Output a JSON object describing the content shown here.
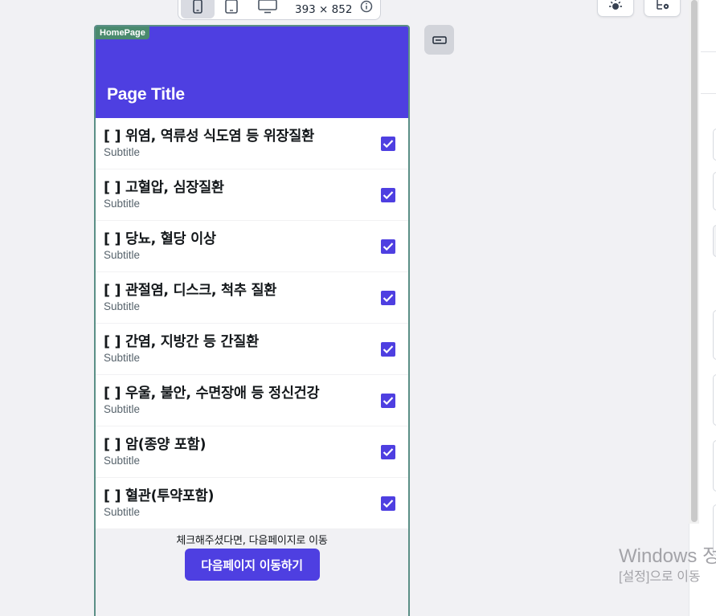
{
  "toolbar": {
    "dimensions": "393 × 852",
    "devices": [
      "mobile",
      "tablet",
      "desktop"
    ],
    "active_device": "mobile"
  },
  "page": {
    "badge": "HomePage",
    "title": "Page Title"
  },
  "items": [
    {
      "title": "[ ] 위염, 역류성 식도염 등 위장질환",
      "subtitle": "Subtitle",
      "checked": true
    },
    {
      "title": "[ ] 고혈압, 심장질환",
      "subtitle": "Subtitle",
      "checked": true
    },
    {
      "title": "[ ] 당뇨, 혈당 이상",
      "subtitle": "Subtitle",
      "checked": true
    },
    {
      "title": "[ ] 관절염, 디스크, 척추 질환",
      "subtitle": "Subtitle",
      "checked": true
    },
    {
      "title": "[ ] 간염, 지방간 등 간질환",
      "subtitle": "Subtitle",
      "checked": true
    },
    {
      "title": "[ ] 우울, 불안, 수면장애 등 정신건강",
      "subtitle": "Subtitle",
      "checked": true
    },
    {
      "title": "[ ] 암(종양 포함)",
      "subtitle": "Subtitle",
      "checked": true
    },
    {
      "title": "[ ] 혈관(투약포함)",
      "subtitle": "Subtitle",
      "checked": true
    }
  ],
  "footer": {
    "hint": "체크해주셨다면, 다음페이지로 이동",
    "next_button": "다음페이지 이동하기"
  },
  "watermark": {
    "line1": "Windows 정",
    "line2": "[설정]으로 이동"
  },
  "colors": {
    "primary": "#4e3fe1",
    "badge": "#4a8a6e",
    "frame_border": "#5b8f86"
  },
  "icons": [
    "mobile-icon",
    "tablet-icon",
    "desktop-icon",
    "info-icon",
    "sun-icon",
    "tree-settings-icon",
    "input-widget-icon",
    "check-icon"
  ]
}
